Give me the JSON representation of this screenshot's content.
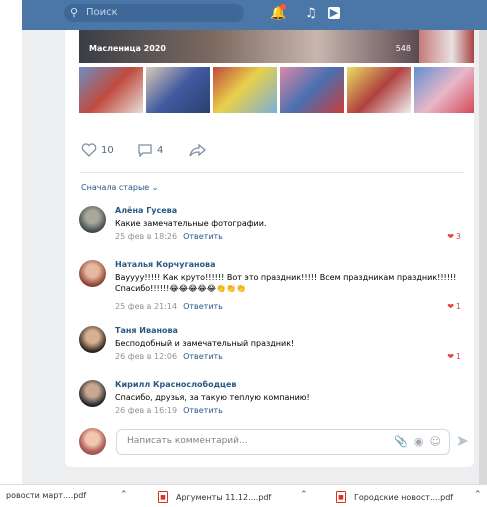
{
  "header": {
    "search_placeholder": "Поиск",
    "icons": [
      "search-icon",
      "bell-icon",
      "music-icon",
      "play-icon"
    ]
  },
  "post": {
    "album_title": "Масленица 2020",
    "album_count": "548",
    "likes": "10",
    "comments": "4"
  },
  "comments_sort": "Сначала старые ⌄",
  "comments": [
    {
      "author": "Алёна Гусева",
      "text": "Какие замечательные фотографии.",
      "date": "25 фев в 18:26",
      "reply": "Ответить",
      "likes": "3"
    },
    {
      "author": "Наталья Корчуганова",
      "text": "Вауууу!!!!! Как круто!!!!!! Вот это праздник!!!!! Всем праздникам праздник!!!!!! Спасибо!!!!!!😂😂😂😂😂👏👏👏",
      "date": "25 фев в 21:14",
      "reply": "Ответить",
      "likes": "1"
    },
    {
      "author": "Таня Иванова",
      "text": "Бесподобный и замечательный праздник!",
      "date": "26 фев в 12:06",
      "reply": "Ответить",
      "likes": "1"
    },
    {
      "author": "Кирилл Краснослободцев",
      "text": "Спасибо, друзья, за такую теплую компанию!",
      "date": "26 фев в 16:19",
      "reply": "Ответить",
      "likes": ""
    }
  ],
  "compose": {
    "placeholder": "Написать комментарий..."
  },
  "downloads": [
    {
      "name": "ровости март....pdf"
    },
    {
      "name": "Аргументы 11.12....pdf"
    },
    {
      "name": "Городские новост....pdf"
    }
  ]
}
